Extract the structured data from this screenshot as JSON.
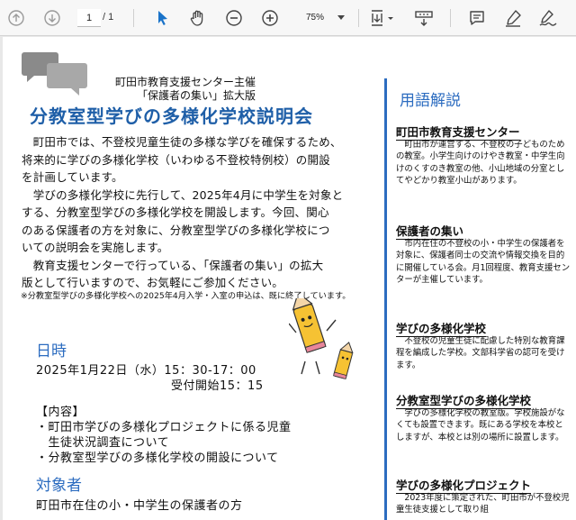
{
  "toolbar": {
    "page_current": "1",
    "page_total": "/ 1",
    "zoom": "75%"
  },
  "doc": {
    "organizer": "町田市教育支援センター主催",
    "subtitle": "「保護者の集い」拡大版",
    "title": "分教室型学びの多様化学校説明会",
    "para1": [
      "　町田市では、不登校児童生徒の多様な学びを確保するため、",
      "将来的に学びの多様化学校（いわゆる不登校特例校）の開設",
      "を計画しています。"
    ],
    "para2": [
      "　学びの多様化学校に先行して、2025年4月に中学生を対象と",
      "する、分教室型学びの多様化学校を開設します。今回、関心",
      "のある保護者の方を対象に、分教室型学びの多様化学校につ",
      "いての説明会を実施します。"
    ],
    "para3": [
      "　教育支援センターで行っている、「保護者の集い」の拡大",
      "版として行いますので、お気軽にご参加ください。"
    ],
    "note": "※分教室型学びの多様化学校への2025年4月入学・入室の申込は、既に終了しています。",
    "datetime_heading": "日時",
    "datetime": "2025年1月22日（水）15：30-17：00",
    "reception": "受付開始15：15",
    "contents_heading": "【内容】",
    "content_item1a": "・町田市学びの多様化プロジェクトに係る児童",
    "content_item1b": "　生徒状況調査について",
    "content_item2": "・分教室型学びの多様化学校の開設について",
    "target_heading": "対象者",
    "target": "町田市在住の小・中学生の保護者の方"
  },
  "glossary": {
    "title": "用語解説",
    "terms": [
      {
        "term": "町田市教育支援センター",
        "def": "　町田市が運営する、不登校の子どものための教室。小学生向けのけやき教室・中学生向けのくすのき教室の他、小山地域の分室としてやどかり教室小山があります。"
      },
      {
        "term": "保護者の集い",
        "def": "　市内在住の不登校の小・中学生の保護者を対象に、保護者同士の交流や情報交換を目的に開催している会。月1回程度、教育支援センターが主催しています。"
      },
      {
        "term": "学びの多様化学校",
        "def": "　不登校の児童生徒に配慮した特別な教育課程を編成した学校。文部科学省の認可を受けます。"
      },
      {
        "term": "分教室型学びの多様化学校",
        "def": "　学びの多様化学校の教室版。学校施設がなくても設置できます。既にある学校を本校としますが、本校とは別の場所に設置します。"
      },
      {
        "term": "学びの多様化プロジェクト",
        "def": "　2023年度に策定された、町田市が不登校児童生徒支援として取り組"
      }
    ]
  }
}
